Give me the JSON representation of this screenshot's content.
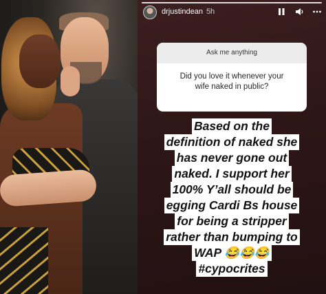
{
  "story": {
    "username": "drjustindean",
    "time": "5h",
    "header_icons": [
      "pause-icon",
      "volume-icon",
      "more-icon"
    ]
  },
  "question_box": {
    "heading": "Ask me anything",
    "question_line1": "Did you love it whenever your",
    "question_line2": "wife naked in public?"
  },
  "caption_lines": [
    "Based on the",
    "definition of naked she",
    "has never gone out",
    "naked. I support her",
    "100% Y’all should be",
    "egging Cardi Bs house",
    "for being a stripper",
    "rather than bumping to",
    "WAP 😂😂😂",
    "#cypocrites"
  ],
  "colors": {
    "story_background": "#2e1617",
    "caption_highlight": "#ffffff",
    "question_header": "#ececec"
  }
}
